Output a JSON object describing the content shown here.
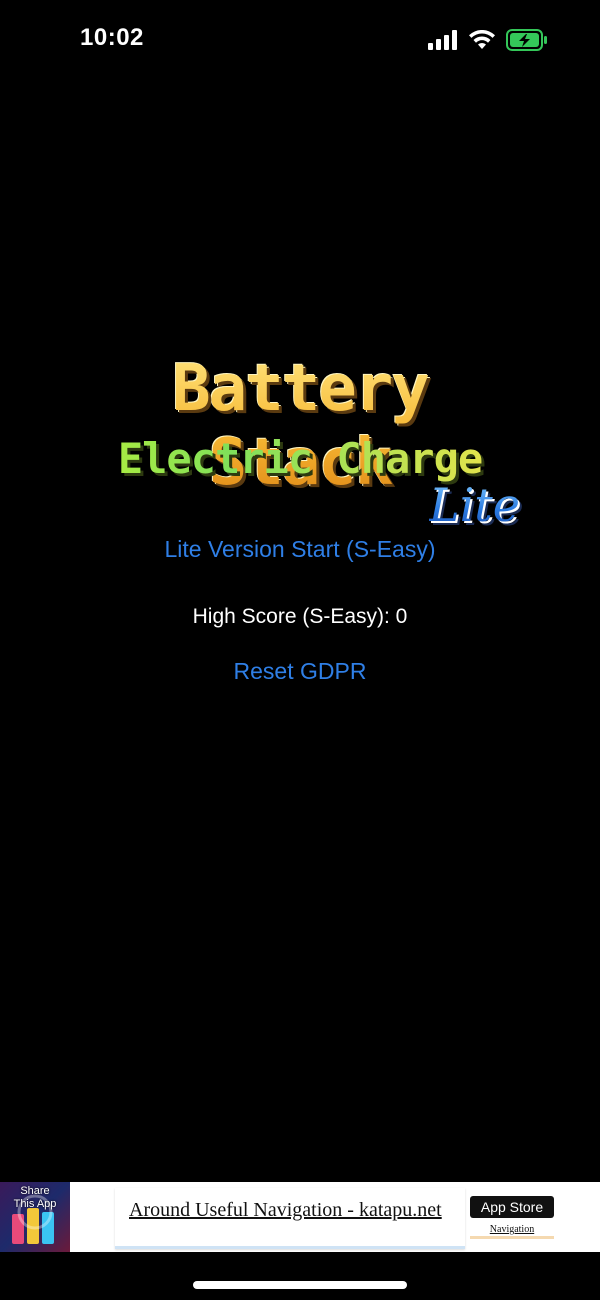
{
  "status_bar": {
    "time": "10:02",
    "icons": [
      "cellular-signal-icon",
      "wifi-icon",
      "battery-charging-icon"
    ],
    "battery_color": "#34c759"
  },
  "logo": {
    "line1": "Battery Stack",
    "line2": "Electric Charge",
    "line3": "Lite"
  },
  "menu": {
    "start_label": "Lite Version Start (S-Easy)",
    "high_score": "High Score (S-Easy): 0",
    "reset_label": "Reset GDPR",
    "link_color": "#2f7fe6"
  },
  "ad": {
    "thumb_text": "Share\nThis App",
    "title": "Around Useful Navigation - katapu.net",
    "store_label": "App Store",
    "category": "Navigation"
  }
}
